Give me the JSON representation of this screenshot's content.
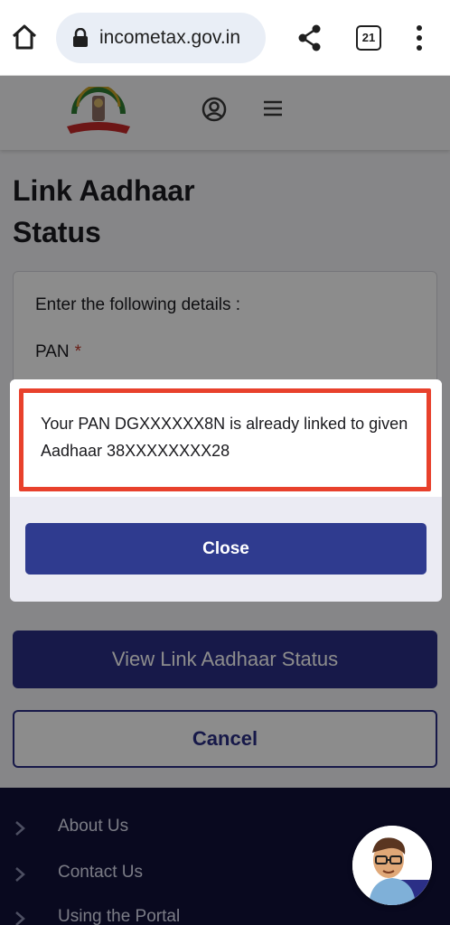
{
  "browser": {
    "url": "incometax.gov.in",
    "tab_count": "21",
    "icons": [
      "home-icon",
      "lock-icon",
      "share-icon",
      "tabs-icon",
      "more-vert-icon"
    ]
  },
  "site_header": {
    "icons": [
      "emblem-logo",
      "profile-icon",
      "hamburger-icon"
    ]
  },
  "page": {
    "title": "Link Aadhaar Status",
    "form_instruction": "Enter the following details :",
    "pan_label": "PAN",
    "pan_required_marker": "*",
    "view_button": "View Link Aadhaar Status",
    "cancel_button": "Cancel"
  },
  "modal": {
    "message": "Your PAN DGXXXXXX8N is already linked to given Aadhaar 38XXXXXXXX28",
    "close_button": "Close"
  },
  "footer": {
    "items": [
      {
        "label": "About Us"
      },
      {
        "label": "Contact Us"
      },
      {
        "label": "Using the Portal"
      }
    ]
  },
  "colors": {
    "primary": "#2b2f86",
    "highlight": "#e8412c",
    "footer_bg": "#12123a"
  }
}
